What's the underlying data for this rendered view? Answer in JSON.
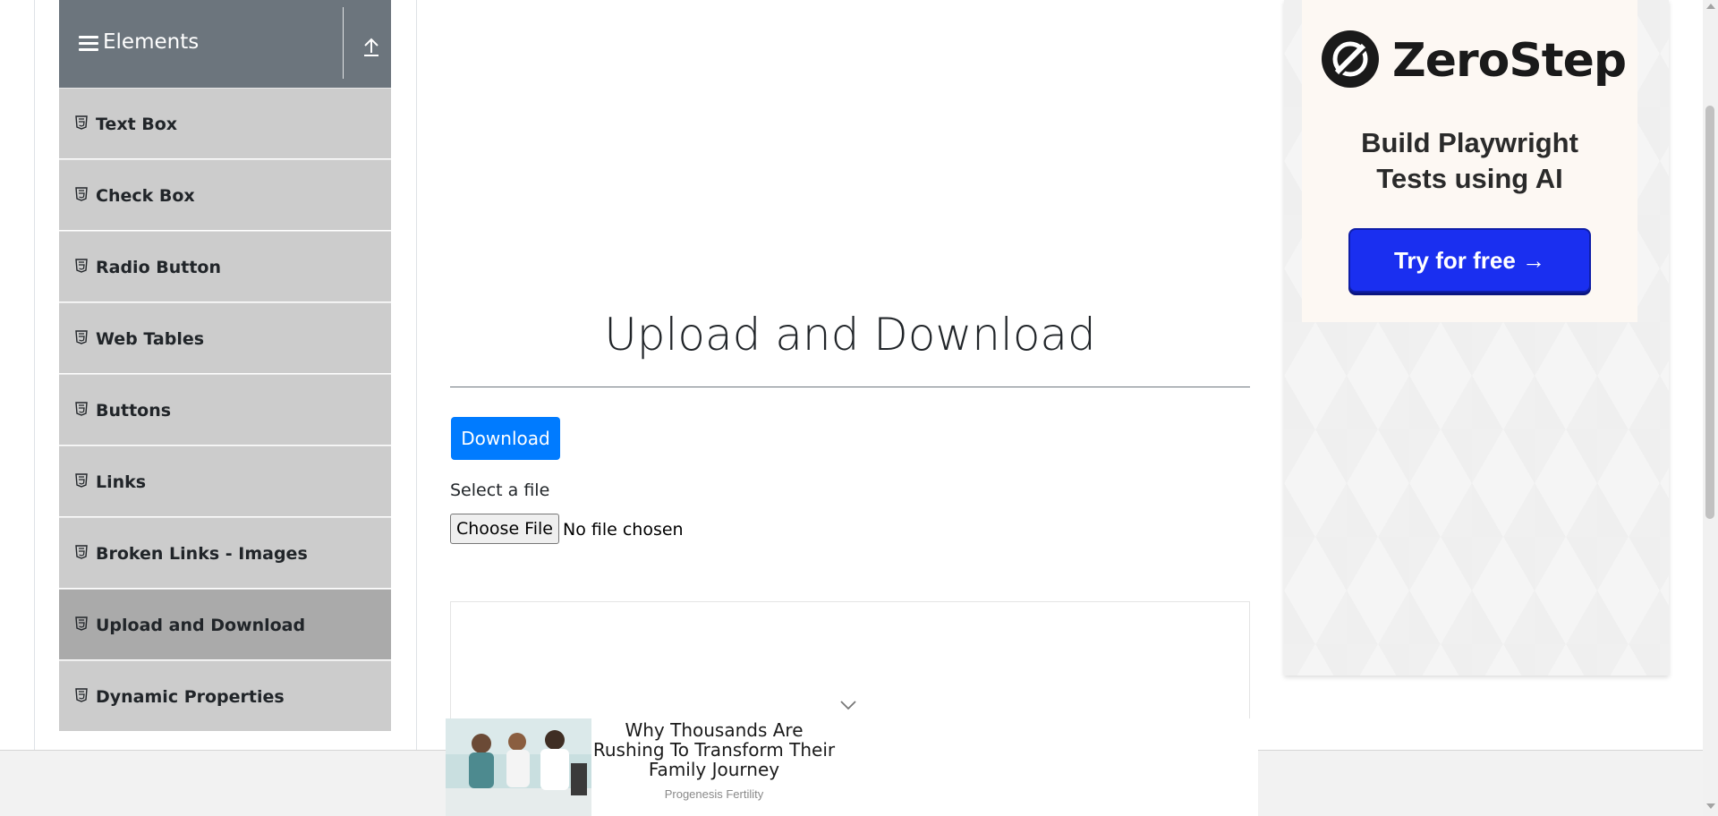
{
  "sidebar": {
    "group_title": "Elements",
    "items": [
      {
        "label": "Text Box",
        "active": false
      },
      {
        "label": "Check Box",
        "active": false
      },
      {
        "label": "Radio Button",
        "active": false
      },
      {
        "label": "Web Tables",
        "active": false
      },
      {
        "label": "Buttons",
        "active": false
      },
      {
        "label": "Links",
        "active": false
      },
      {
        "label": "Broken Links - Images",
        "active": false
      },
      {
        "label": "Upload and Download",
        "active": true
      },
      {
        "label": "Dynamic Properties",
        "active": false
      }
    ]
  },
  "main": {
    "title": "Upload and Download",
    "download_label": "Download",
    "select_label": "Select a file",
    "choose_file_label": "Choose File",
    "no_file_text": "No file chosen"
  },
  "right_ad": {
    "brand": "ZeroStep",
    "tagline_line1": "Build Playwright",
    "tagline_line2": "Tests using AI",
    "cta_label": "Try for free →",
    "cta_color": "#1a2ff0"
  },
  "bottom_ad": {
    "headline": "Why Thousands Are Rushing To Transform Their Family Journey",
    "source": "Progenesis Fertility"
  },
  "colors": {
    "sidebar_header": "#6c757d",
    "menu_item": "#cccccc",
    "menu_item_active": "#aaaaaa",
    "primary_button": "#007bff"
  },
  "icons": {
    "group": "hamburger-icon",
    "collapse": "upload-arrow-icon",
    "menu_item": "html5-icon",
    "ad_expand": "chevron-down-icon"
  }
}
